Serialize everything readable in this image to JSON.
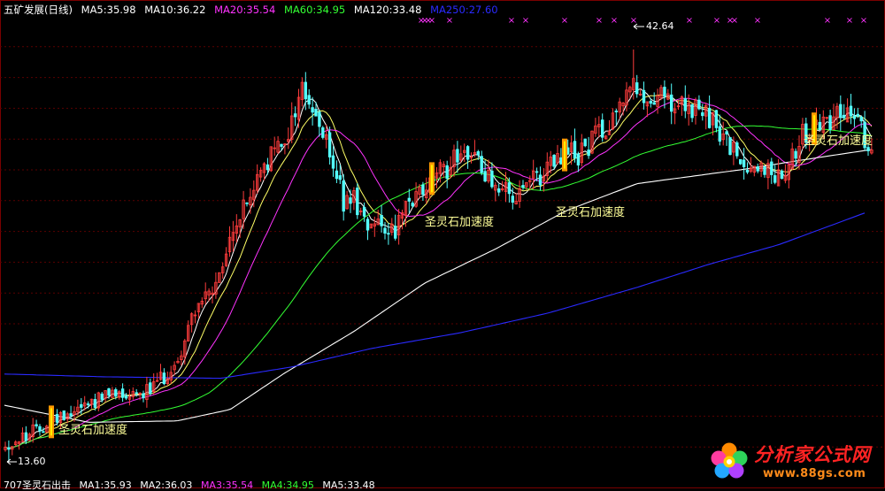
{
  "header": {
    "title": "五矿发展(日线)",
    "ma_items": [
      {
        "label": "MA5:35.98",
        "color": "#ffffff"
      },
      {
        "label": "MA10:36.22",
        "color": "#ffffff"
      },
      {
        "label": "MA20:35.54",
        "color": "#ff33ff"
      },
      {
        "label": "MA60:34.95",
        "color": "#33ff33"
      },
      {
        "label": "MA120:33.48",
        "color": "#ffffff"
      },
      {
        "label": "MA250:27.60",
        "color": "#2222ff"
      }
    ]
  },
  "bottom_indicator": {
    "items": [
      {
        "label": "707圣灵石出击",
        "color": "#ffffff"
      },
      {
        "label": "MA1:35.93",
        "color": "#ffffff"
      },
      {
        "label": "MA2:36.03",
        "color": "#ffffff"
      },
      {
        "label": "MA3:35.54",
        "color": "#ff33ff"
      },
      {
        "label": "MA4:34.95",
        "color": "#33ff33"
      },
      {
        "label": "MA5:33.48",
        "color": "#ffffff"
      }
    ]
  },
  "annotations": {
    "high_label": "42.64",
    "low_label": "13.60",
    "signal_text": "圣灵石加速度"
  },
  "watermark": {
    "title": "分析家公式网",
    "url": "www.88gs.com"
  },
  "chart_data": {
    "type": "candlestick",
    "ylim": [
      12.5,
      45
    ],
    "grid": true,
    "high": 42.64,
    "low": 13.6,
    "signal_days": [
      58,
      488,
      638,
      920
    ],
    "ma_end_values": {
      "MA5": 35.98,
      "MA10": 36.22,
      "MA20": 35.54,
      "MA60": 34.95,
      "MA120": 33.48,
      "MA250": 27.6
    },
    "colors": {
      "up": "#ff3c3c",
      "down": "#54ffff",
      "ma5": "#ffffff",
      "ma10": "#ffff66",
      "ma20": "#ff33ff",
      "ma60": "#33ff33",
      "ma120": "#ffffff",
      "ma250": "#2a2aff",
      "signal_bar": "#ff9900",
      "signal_bar_inner": "#ffee00",
      "marker": "#ff33ff"
    }
  }
}
